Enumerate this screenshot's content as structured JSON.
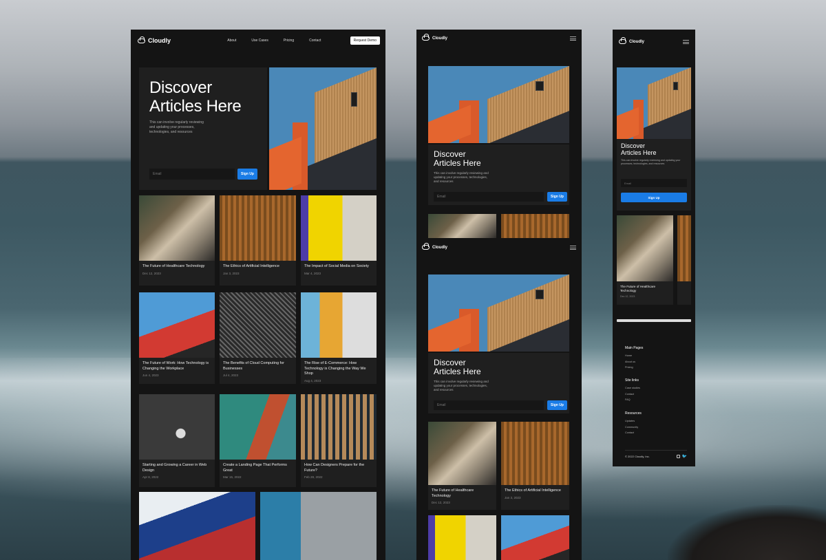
{
  "brand": {
    "name": "Cloudly"
  },
  "nav": {
    "links": [
      "About",
      "Use Cases",
      "Pricing",
      "Contact"
    ],
    "cta": "Request Demo"
  },
  "hero": {
    "title_line1": "Discover",
    "title_line2": "Articles Here",
    "subtitle": "This can involve regularly reviewing and updating your processes, technologies, and resources",
    "email_placeholder": "Email",
    "signup": "Sign Up"
  },
  "articles": [
    {
      "title": "The Future of Healthcare Technology",
      "date": "Dec 12, 2023"
    },
    {
      "title": "The Ethics of Artificial Intelligence",
      "date": "Jan 3, 2023"
    },
    {
      "title": "The Impact of Social Media on Society",
      "date": "Mar 4, 2023"
    },
    {
      "title": "The Future of Work: How Technology is Changing the Workplace",
      "date": "Jun 4, 2023"
    },
    {
      "title": "The Benefits of Cloud Computing for Businesses",
      "date": "Jul 4, 2023"
    },
    {
      "title": "The Rise of E-Commerce: How Technology is Changing the Way We Shop",
      "date": "Aug 4, 2023"
    },
    {
      "title": "Starting and Growing a Career in Web Design",
      "date": "Apr 8, 2022"
    },
    {
      "title": "Create a Landing Page That Performs Great",
      "date": "Mar 15, 2022"
    },
    {
      "title": "How Can Designers Prepare for the Future?",
      "date": "Feb 28, 2022"
    }
  ],
  "footer": {
    "main_pages": {
      "title": "Main Pages",
      "items": [
        "Home",
        "About us",
        "Pricing"
      ]
    },
    "site_links": {
      "title": "Site links",
      "items": [
        "Case studies",
        "Contact",
        "FAQ"
      ]
    },
    "resources": {
      "title": "Resources",
      "items": [
        "Updates",
        "Community",
        "Contact"
      ]
    },
    "copyright": "© 2022 Cloudly, Inc."
  },
  "colors": {
    "accent": "#1a7ce6",
    "panel": "#1f1f1f",
    "page": "#141414"
  }
}
